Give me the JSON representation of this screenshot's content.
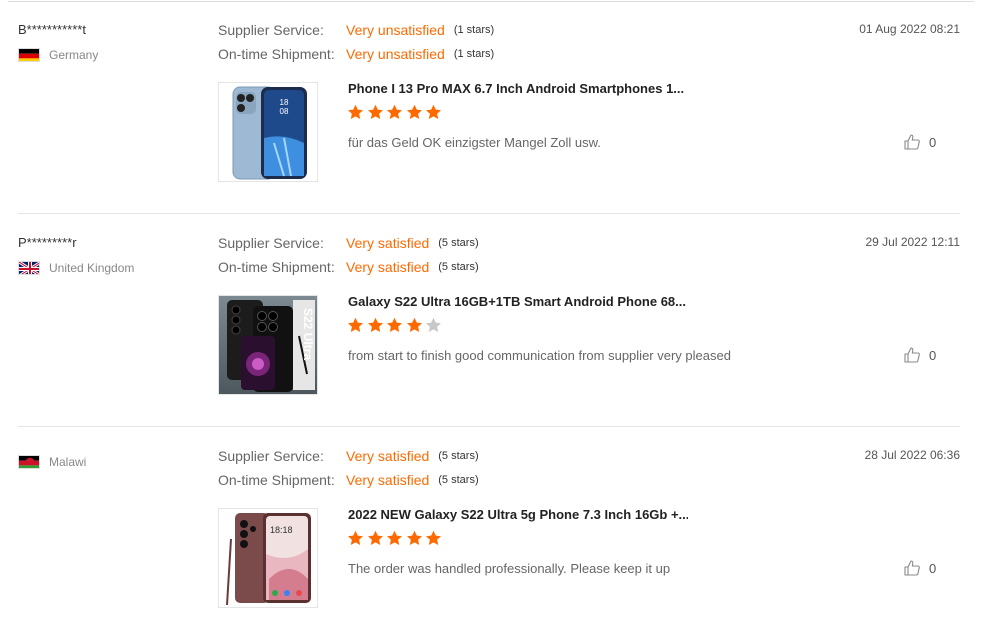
{
  "colors": {
    "accent": "#ff6a00",
    "star_filled": "#ff6a00",
    "star_empty": "#c8c8c8"
  },
  "labels": {
    "supplier_service": "Supplier Service:",
    "ontime_shipment": "On-time Shipment:"
  },
  "reviews": [
    {
      "user": "B***********t",
      "country": "Germany",
      "flag": "germany",
      "date": "01 Aug 2022 08:21",
      "supplier_value": "Very unsatisfied",
      "supplier_stars": "(1 stars)",
      "shipment_value": "Very unsatisfied",
      "shipment_stars": "(1 stars)",
      "product_title": "Phone I 13 Pro MAX 6.7 Inch Android Smartphones 1...",
      "rating": 5,
      "comment": "für das Geld OK einzigster Mangel Zoll usw.",
      "likes": "0",
      "thumb_icon": "phone-blue-thumbnail"
    },
    {
      "user": "P*********r",
      "country": "United Kingdom",
      "flag": "uk",
      "date": "29 Jul 2022 12:11",
      "supplier_value": "Very satisfied",
      "supplier_stars": "(5 stars)",
      "shipment_value": "Very satisfied",
      "shipment_stars": "(5 stars)",
      "product_title": "Galaxy S22 Ultra 16GB+1TB Smart Android Phone 68...",
      "rating": 4,
      "comment": "from start to finish good communication from supplier very pleased",
      "likes": "0",
      "thumb_icon": "phone-black-thumbnail",
      "thumb_text": "S22 Ultra"
    },
    {
      "user": "",
      "country": "Malawi",
      "flag": "malawi",
      "date": "28 Jul 2022 06:36",
      "supplier_value": "Very satisfied",
      "supplier_stars": "(5 stars)",
      "shipment_value": "Very satisfied",
      "shipment_stars": "(5 stars)",
      "product_title": "2022 NEW Galaxy S22 Ultra 5g Phone 7.3 Inch 16Gb +...",
      "rating": 5,
      "comment": "The order was handled professionally. Please keep it up",
      "likes": "0",
      "thumb_icon": "phone-burgundy-thumbnail",
      "thumb_clock": "18:18"
    }
  ]
}
